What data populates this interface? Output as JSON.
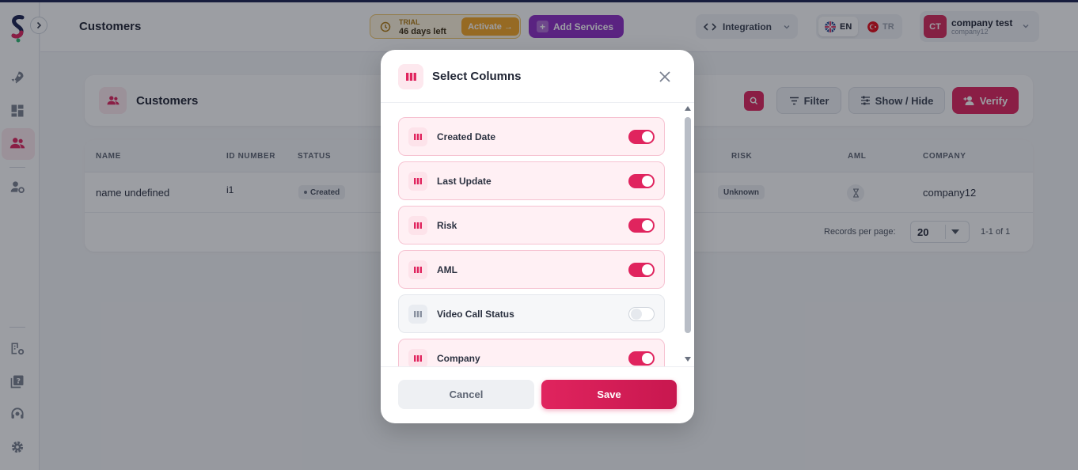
{
  "header": {
    "page_title": "Customers",
    "trial": {
      "label": "TRIAL",
      "days_left": "46 days left",
      "activate_label": "Activate →"
    },
    "add_services_label": "Add Services",
    "integration_label": "Integration",
    "languages": [
      {
        "code": "EN",
        "active": true
      },
      {
        "code": "TR",
        "active": false
      }
    ],
    "user": {
      "initials": "CT",
      "name": "company test",
      "company": "company12"
    }
  },
  "panel": {
    "title": "Customers",
    "filter_label": "Filter",
    "show_hide_label": "Show / Hide",
    "verify_label": "Verify"
  },
  "table": {
    "columns": {
      "name": "NAME",
      "id_number": "ID NUMBER",
      "status": "STATUS",
      "risk": "RISK",
      "aml": "AML",
      "company": "COMPANY"
    },
    "rows": [
      {
        "name": "name undefined",
        "id_number": "i1",
        "status": "Created",
        "risk": "Unknown",
        "company": "company12"
      }
    ],
    "records_per_page_label": "Records per page:",
    "records_per_page": "20",
    "range": "1-1 of 1"
  },
  "modal": {
    "title": "Select Columns",
    "columns": [
      {
        "label": "Created Date",
        "enabled": true
      },
      {
        "label": "Last Update",
        "enabled": true
      },
      {
        "label": "Risk",
        "enabled": true
      },
      {
        "label": "AML",
        "enabled": true
      },
      {
        "label": "Video Call Status",
        "enabled": false
      },
      {
        "label": "Company",
        "enabled": true
      }
    ],
    "cancel_label": "Cancel",
    "save_label": "Save"
  },
  "colors": {
    "accent": "#e0245e",
    "purple": "#8e2bc4",
    "trial": "#f5a623"
  },
  "icons": [
    "logo-icon",
    "chevron-right-icon",
    "rocket-icon",
    "dashboard-icon",
    "users-icon",
    "user-settings-icon",
    "building-settings-icon",
    "help-icon",
    "support-icon",
    "gear-icon",
    "clock-icon",
    "code-icon",
    "chevron-down-icon",
    "search-icon",
    "filter-icon",
    "sliders-icon",
    "user-plus-icon",
    "hourglass-icon",
    "columns-icon",
    "close-icon"
  ]
}
